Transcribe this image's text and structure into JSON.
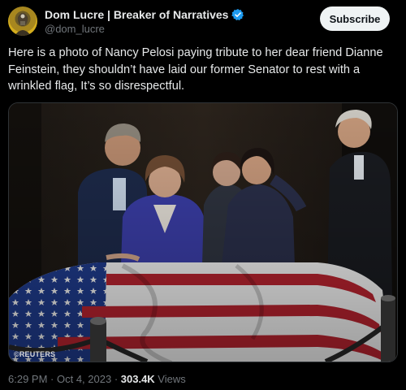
{
  "author": {
    "display_name": "Dom Lucre | Breaker of Narratives",
    "handle": "@dom_lucre",
    "verified_icon": "verified-badge-icon",
    "avatar_icon": "avatar"
  },
  "actions": {
    "subscribe_label": "Subscribe"
  },
  "tweet": {
    "text": "Here is a photo of Nancy Pelosi paying tribute to her dear friend Dianne Feinstein, they shouldn’t have laid our former Senator to rest with a wrinkled flag, It’s so disrespectful."
  },
  "media": {
    "credit": "©REUTERS"
  },
  "meta": {
    "time": "6:29 PM",
    "separator": " · ",
    "date": "Oct 4, 2023",
    "separator2": " · ",
    "views_count": "303.4K",
    "views_label": " Views"
  },
  "colors": {
    "background": "#000000",
    "text_primary": "#e7e9ea",
    "text_secondary": "#71767b",
    "verified": "#1d9bf0",
    "subscribe_bg": "#eff3f4"
  }
}
